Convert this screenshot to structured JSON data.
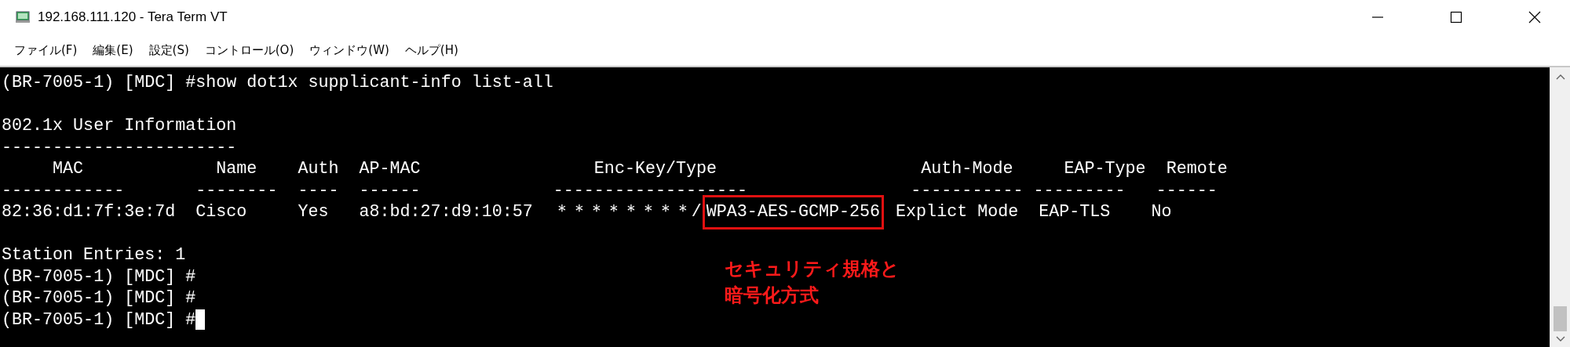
{
  "window": {
    "title": "192.168.111.120 - Tera Term VT"
  },
  "menu": [
    {
      "label": "ファイル(F)"
    },
    {
      "label": "編集(E)"
    },
    {
      "label": "設定(S)"
    },
    {
      "label": "コントロール(O)"
    },
    {
      "label": "ウィンドウ(W)"
    },
    {
      "label": "ヘルプ(H)"
    }
  ],
  "terminal": {
    "lines": [
      {
        "kind": "text",
        "text": "(BR-7005-1) [MDC] #show dot1x supplicant-info list-all"
      },
      {
        "kind": "blank"
      },
      {
        "kind": "text",
        "text": "802.1x User Information"
      },
      {
        "kind": "text",
        "text": "-----------------------"
      },
      {
        "kind": "text",
        "text": "     MAC             Name    Auth  AP-MAC                 Enc-Key/Type                    Auth-Mode     EAP-Type  Remote"
      },
      {
        "kind": "text",
        "text": "------------       --------  ----  ------             -------------------                ----------- ---------   ------"
      },
      {
        "kind": "highlighted",
        "before": "82:36:d1:7f:3e:7d  Cisco     Yes   a8:bd:27:d9:10:57  ＊＊＊＊＊＊＊＊/",
        "highlight": "WPA3-AES-GCMP-256",
        "after": " Explict Mode  EAP-TLS    No"
      },
      {
        "kind": "blank"
      },
      {
        "kind": "text",
        "text": "Station Entries: 1"
      },
      {
        "kind": "text",
        "text": "(BR-7005-1) [MDC] #"
      },
      {
        "kind": "text",
        "text": "(BR-7005-1) [MDC] #"
      },
      {
        "kind": "text",
        "text": "(BR-7005-1) [MDC] #",
        "cursor": true
      }
    ]
  },
  "annotation": {
    "lines": [
      "セキュリティ規格と",
      "暗号化方式"
    ]
  }
}
